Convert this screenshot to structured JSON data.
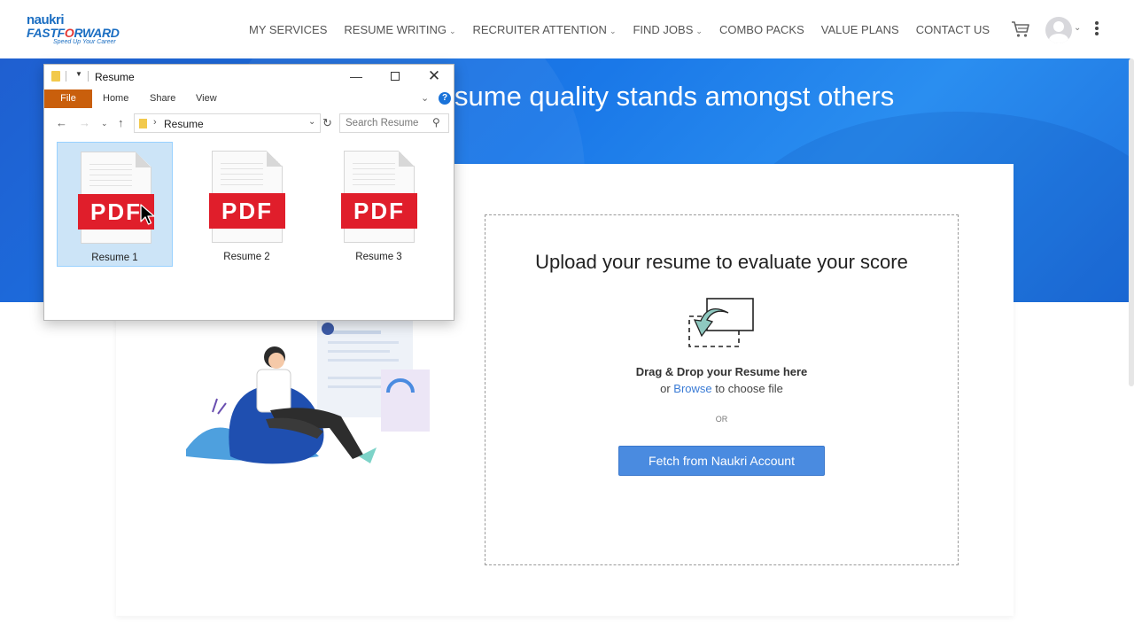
{
  "brand": {
    "logo_line1": "naukri",
    "logo_line2_a": "FASTF",
    "logo_line2_o": "O",
    "logo_line2_b": "RWARD",
    "logo_tagline": "Speed Up Your Career"
  },
  "nav": {
    "items": [
      {
        "label": "MY SERVICES",
        "has_dropdown": false
      },
      {
        "label": "RESUME WRITING",
        "has_dropdown": true
      },
      {
        "label": "RECRUITER ATTENTION",
        "has_dropdown": true
      },
      {
        "label": "FIND JOBS",
        "has_dropdown": true
      },
      {
        "label": "COMBO PACKS",
        "has_dropdown": false
      },
      {
        "label": "VALUE PLANS",
        "has_dropdown": false
      },
      {
        "label": "CONTACT US",
        "has_dropdown": false
      }
    ],
    "icons": {
      "cart": "cart-icon",
      "avatar": "user-avatar-icon",
      "menu": "kebab-menu-icon"
    }
  },
  "hero": {
    "title_visible": "sume quality stands amongst others"
  },
  "upload": {
    "title": "Upload your resume to evaluate your score",
    "drag_text": "Drag & Drop your Resume here",
    "browse_prefix": "or",
    "browse_link": "Browse",
    "browse_suffix": "to choose file",
    "or_text": "OR",
    "fetch_button": "Fetch from Naukri Account"
  },
  "explorer": {
    "title": "Resume",
    "ribbon_tabs": [
      "File",
      "Home",
      "Share",
      "View"
    ],
    "address_crumb": "Resume",
    "search_placeholder": "Search Resume",
    "help_glyph": "?",
    "files": [
      {
        "name": "Resume 1",
        "badge": "PDF",
        "selected": true
      },
      {
        "name": "Resume 2",
        "badge": "PDF",
        "selected": false
      },
      {
        "name": "Resume 3",
        "badge": "PDF",
        "selected": false
      }
    ]
  },
  "colors": {
    "brand_blue": "#1b6ec2",
    "hero_blue": "#1a78e8",
    "button_blue": "#4a8be0",
    "link_blue": "#3a7bd5",
    "pdf_red": "#e01e2b",
    "file_tab_orange": "#c95f0c",
    "selection_blue": "#cce4f7"
  }
}
